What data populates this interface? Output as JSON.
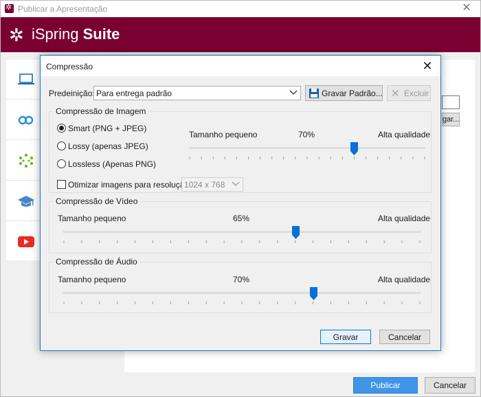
{
  "window": {
    "title": "Publicar a Apresentação"
  },
  "brand": {
    "name_part1": "iSpring",
    "name_part2": "Suite",
    "color": "#7a0032"
  },
  "nav": [
    {
      "icon": "laptop-icon"
    },
    {
      "icon": "cloud-link-icon"
    },
    {
      "icon": "ispring-flower-icon"
    },
    {
      "icon": "graduation-cap-icon"
    },
    {
      "icon": "youtube-icon"
    }
  ],
  "background_panel": {
    "browse_button_fragment": "gar..."
  },
  "footer": {
    "publish_label": "Publicar",
    "cancel_label": "Cancelar"
  },
  "dialog": {
    "title": "Compressão",
    "preset": {
      "label": "Predeinição:",
      "selected": "Para entrega padrão",
      "save_label": "Gravar Padrão...",
      "delete_label": "Excluir"
    },
    "image": {
      "title": "Compressão de Imagem",
      "options": [
        {
          "label": "Smart (PNG + JPEG)",
          "selected": true
        },
        {
          "label": "Lossy (apenas JPEG)",
          "selected": false
        },
        {
          "label": "Lossless (Apenas PNG)",
          "selected": false
        }
      ],
      "slider": {
        "min_label": "Tamanho pequeno",
        "value_label": "70%",
        "max_label": "Alta qualidade",
        "value": 0.7
      },
      "optimize_label": "Otimizar imagens para resolução:",
      "optimize_checked": false,
      "resolution": "1024 x 768"
    },
    "video": {
      "title": "Compressão de Vídeo",
      "slider": {
        "min_label": "Tamanho pequeno",
        "value_label": "65%",
        "max_label": "Alta qualidade",
        "value": 0.65
      }
    },
    "audio": {
      "title": "Compressão de Áudio",
      "slider": {
        "min_label": "Tamanho pequeno",
        "value_label": "70%",
        "max_label": "Alta qualidade",
        "value": 0.7
      }
    },
    "save_label": "Gravar",
    "cancel_label": "Cancelar"
  }
}
